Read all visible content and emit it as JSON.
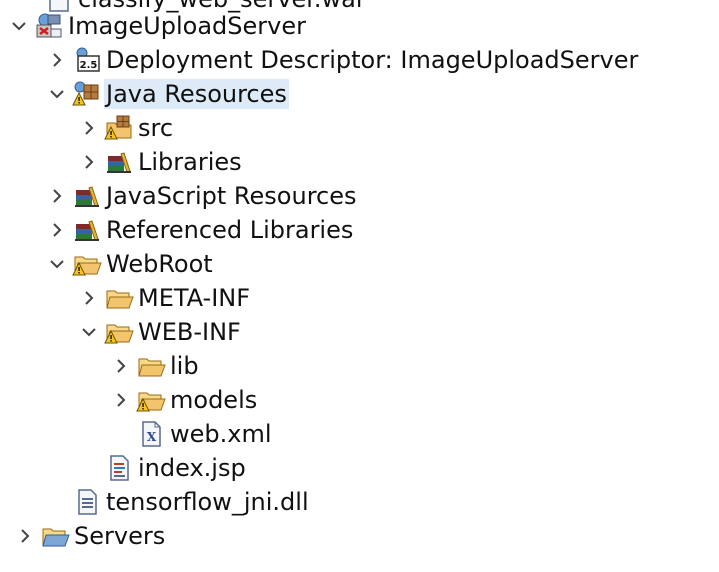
{
  "tree": {
    "top_partial_label": "classify_web_server.war",
    "project": "ImageUploadServer",
    "deployment_descriptor": "Deployment Descriptor: ImageUploadServer",
    "java_resources": "Java Resources",
    "src": "src",
    "libraries": "Libraries",
    "javascript_resources": "JavaScript Resources",
    "referenced_libraries": "Referenced Libraries",
    "webroot": "WebRoot",
    "meta_inf": "META-INF",
    "web_inf": "WEB-INF",
    "lib": "lib",
    "models": "models",
    "web_xml": "web.xml",
    "index_jsp": "index.jsp",
    "tensorflow_dll": "tensorflow_jni.dll",
    "servers": "Servers"
  },
  "colors": {
    "selection": "#ddeaf7",
    "folder": "#e8b54a",
    "chevron": "#444444"
  }
}
